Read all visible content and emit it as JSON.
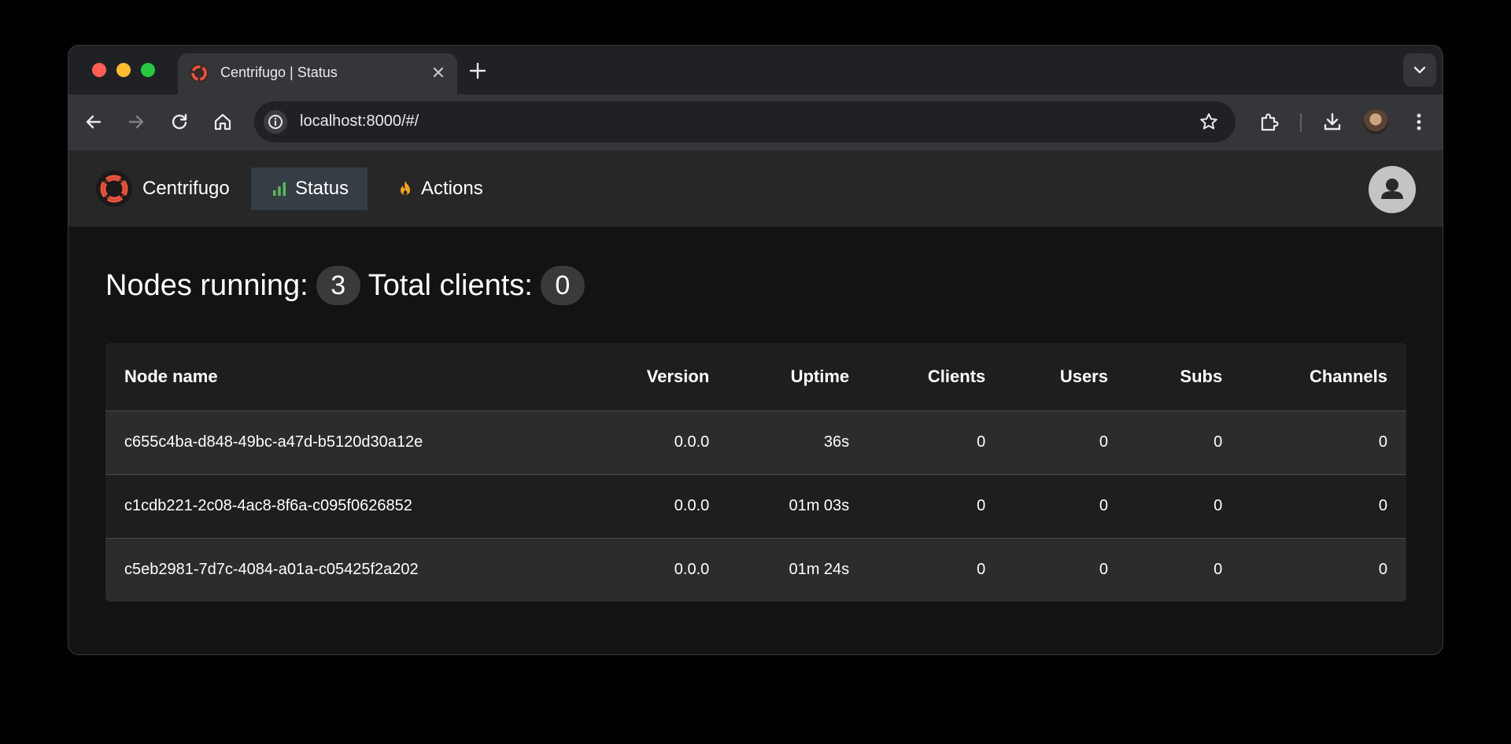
{
  "browser": {
    "tab_title": "Centrifugo | Status",
    "url": "localhost:8000/#/"
  },
  "app": {
    "brand": "Centrifugo",
    "nav": {
      "status_label": "Status",
      "actions_label": "Actions"
    },
    "accent_color": "#e8553e"
  },
  "summary": {
    "nodes_label": "Nodes running:",
    "nodes_count": "3",
    "clients_label": "Total clients:",
    "clients_count": "0"
  },
  "table": {
    "headers": [
      "Node name",
      "Version",
      "Uptime",
      "Clients",
      "Users",
      "Subs",
      "Channels"
    ],
    "rows": [
      [
        "c655c4ba-d848-49bc-a47d-b5120d30a12e",
        "0.0.0",
        "36s",
        "0",
        "0",
        "0",
        "0"
      ],
      [
        "c1cdb221-2c08-4ac8-8f6a-c095f0626852",
        "0.0.0",
        "01m 03s",
        "0",
        "0",
        "0",
        "0"
      ],
      [
        "c5eb2981-7d7c-4084-a01a-c05425f2a202",
        "0.0.0",
        "01m 24s",
        "0",
        "0",
        "0",
        "0"
      ]
    ]
  }
}
